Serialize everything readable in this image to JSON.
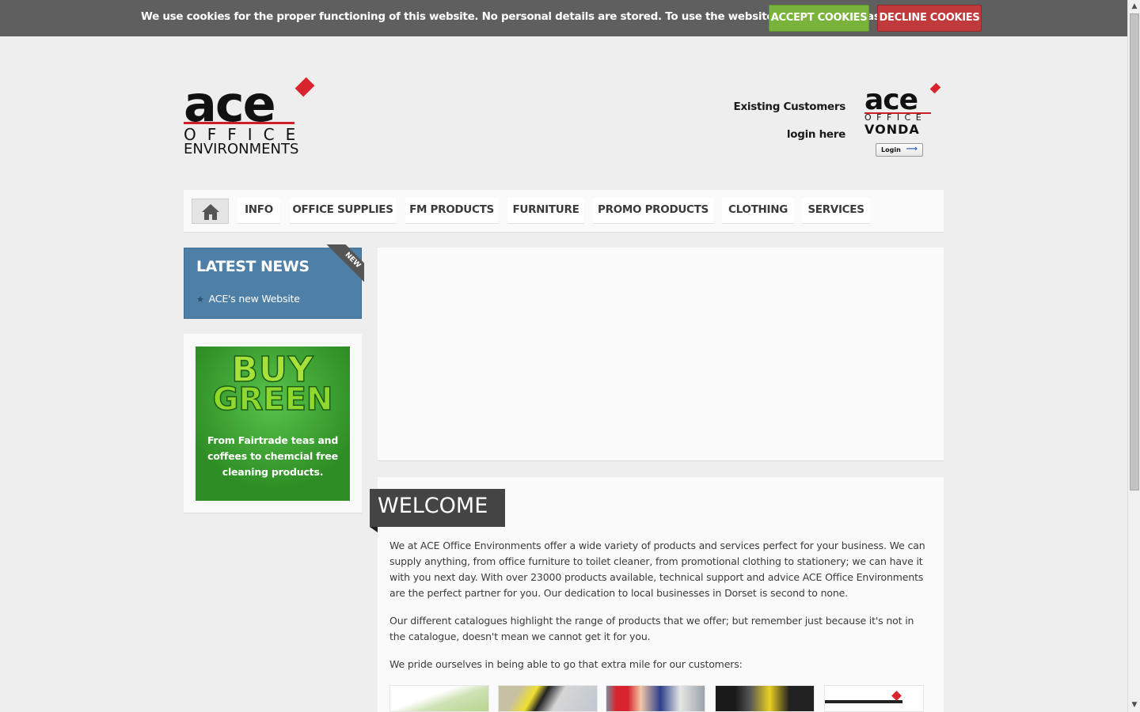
{
  "cookie_bar": {
    "message": "We use cookies for the proper functioning of this website. No personal details are stored. To use the website as intended please...",
    "accept_label": "ACCEPT COOKIES",
    "decline_label": "DECLINE COOKIES",
    "accept_color": "#79b33b",
    "decline_color": "#c0393b"
  },
  "header": {
    "logo": {
      "word": "ace",
      "line2": "OFFICE",
      "line3": "ENVIRONMENTS",
      "accent": "#d8242c"
    },
    "existing_customers": "Existing Customers",
    "login_here": "login here",
    "vonda_logo": {
      "word": "ace",
      "line2": "OFFICE",
      "line3": "VONDA"
    },
    "vonda_login_label": "Login"
  },
  "nav": {
    "home_icon": "home-icon",
    "items": [
      {
        "label": "INFO"
      },
      {
        "label": "OFFICE SUPPLIES"
      },
      {
        "label": "FM PRODUCTS"
      },
      {
        "label": "FURNITURE"
      },
      {
        "label": "PROMO PRODUCTS"
      },
      {
        "label": "CLOTHING"
      },
      {
        "label": "SERVICES"
      }
    ]
  },
  "sidebar": {
    "news": {
      "title": "LATEST NEWS",
      "ribbon": "NEW",
      "items": [
        {
          "label": "ACE's new Website"
        }
      ],
      "color": "#4e7fa6"
    },
    "buy_green": {
      "title_line1": "BUY",
      "title_line2": "GREEN",
      "text": "From Fairtrade teas and coffees to chemcial free cleaning products."
    }
  },
  "main": {
    "welcome_title": "WELCOME",
    "paragraphs": [
      "We at ACE Office Environments offer a wide variety of products and services perfect for your business. We can supply anything, from office furniture to toilet cleaner, from promotional clothing to stationery; we can have it with you next day. With over 23000 products available, technical support and advice ACE Office Environments are the perfect partner for you. Our dedication to local businesses in Dorset is second to none.",
      "Our different catalogues highlight the range of products that we offer; but remember just because it's not in the catalogue, doesn't mean we cannot get it for you.",
      "We pride ourselves in being able to go that extra mile for our customers:"
    ]
  }
}
